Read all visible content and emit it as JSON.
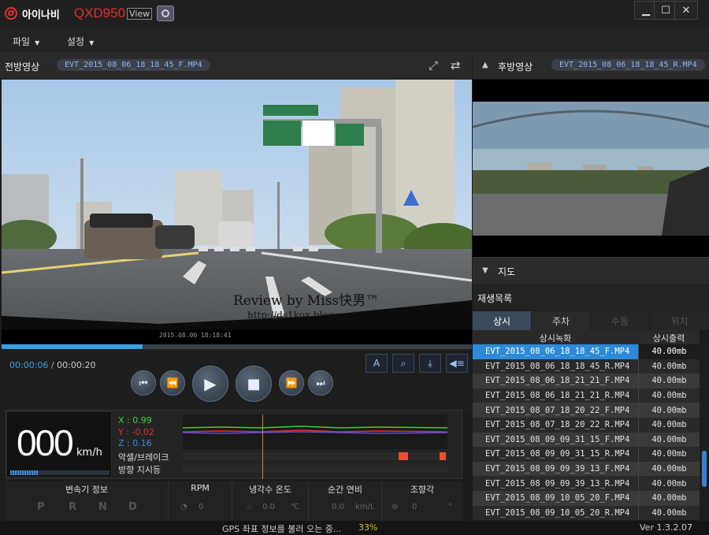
{
  "app": {
    "brand": "아이나비",
    "model": "QXD950",
    "view_tag": "View",
    "window_buttons": [
      "▁",
      "☐",
      "✕"
    ]
  },
  "menu": {
    "items": [
      {
        "label": "파일"
      },
      {
        "label": "설정"
      }
    ]
  },
  "front": {
    "label": "전방영상",
    "filename": "EVT_2015_08_06_18_18_45_F.MP4",
    "watermark_line1": "Review by Miss快男™",
    "watermark_line2": "http://ds1kox.blog.me/",
    "overlay_stamp": "2015.08.06 18:18:41",
    "progress": 0.3
  },
  "rear": {
    "label": "후방영상",
    "filename": "EVT_2015_08_06_18_18_45_R.MP4"
  },
  "player": {
    "current_time": "00:00:06",
    "separator": "/",
    "total_time": "00:00:20"
  },
  "speed": {
    "value": "000",
    "unit": "km/h"
  },
  "gsensor": {
    "x_label": "X : 0.99",
    "y_label": "Y : -0.02",
    "z_label": "Z : 0.16",
    "x_color": "#3ccf3c",
    "y_color": "#e03030",
    "z_color": "#3a8ee0",
    "accel_label": "악셀/브레이크",
    "turn_label": "방향 지시등"
  },
  "obd": {
    "transmission_label": "변속기 정보",
    "gears": [
      "P",
      "R",
      "N",
      "D"
    ],
    "rpm_label": "RPM",
    "rpm_value": "0",
    "coolant_label": "냉각수 온도",
    "coolant_value": "0.0",
    "coolant_unit": "℃",
    "fuel_label": "순간 연비",
    "fuel_value": "0.0",
    "fuel_unit": "km/L",
    "steering_label": "조향각",
    "steering_value": "0",
    "steering_unit": "°"
  },
  "status": {
    "message": "GPS 좌표 정보를 불러 오는 중...",
    "percent": "33%",
    "version": "Ver 1.3.2.07"
  },
  "map_section": {
    "label": "지도"
  },
  "playlist": {
    "label": "재생목록",
    "tabs": [
      "상시",
      "주차",
      "수동",
      "위치"
    ],
    "col_file": "상시녹화",
    "col_size": "상시출력",
    "files": [
      {
        "name": "EVT_2015_08_06_18_18_45_F.MP4",
        "size": "40.00mb",
        "selected": true
      },
      {
        "name": "EVT_2015_08_06_18_18_45_R.MP4",
        "size": "40.00mb"
      },
      {
        "name": "EVT_2015_08_06_18_21_21_F.MP4",
        "size": "40.00mb"
      },
      {
        "name": "EVT_2015_08_06_18_21_21_R.MP4",
        "size": "40.00mb"
      },
      {
        "name": "EVT_2015_08_07_18_20_22_F.MP4",
        "size": "40.00mb"
      },
      {
        "name": "EVT_2015_08_07_18_20_22_R.MP4",
        "size": "40.00mb"
      },
      {
        "name": "EVT_2015_08_09_09_31_15_F.MP4",
        "size": "40.00mb"
      },
      {
        "name": "EVT_2015_08_09_09_31_15_R.MP4",
        "size": "40.00mb"
      },
      {
        "name": "EVT_2015_08_09_09_39_13_F.MP4",
        "size": "40.00mb"
      },
      {
        "name": "EVT_2015_08_09_09_39_13_R.MP4",
        "size": "40.00mb"
      },
      {
        "name": "EVT_2015_08_09_10_05_20_F.MP4",
        "size": "40.00mb"
      },
      {
        "name": "EVT_2015_08_09_10_05_20_R.MP4",
        "size": "40.00mb"
      }
    ]
  }
}
